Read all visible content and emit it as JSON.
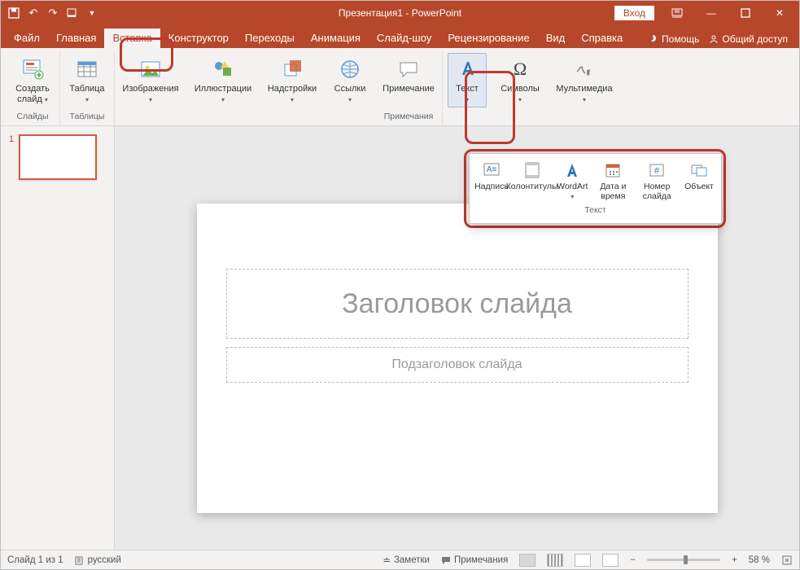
{
  "title": "Презентация1 - PowerPoint",
  "login_label": "Вход",
  "tabs": {
    "file": "Файл",
    "home": "Главная",
    "insert": "Вставка",
    "design": "Конструктор",
    "transitions": "Переходы",
    "animation": "Анимация",
    "slideshow": "Слайд-шоу",
    "review": "Рецензирование",
    "view": "Вид",
    "help": "Справка"
  },
  "tabs_right": {
    "tell_me": "Помощь",
    "share": "Общий доступ"
  },
  "ribbon": {
    "new_slide": "Создать слайд",
    "slides_group": "Слайды",
    "table": "Таблица",
    "tables_group": "Таблицы",
    "images": "Изображения",
    "illustrations": "Иллюстрации",
    "addins": "Надстройки",
    "links": "Ссылки",
    "comment": "Примечание",
    "comments_group": "Примечания",
    "text": "Текст",
    "symbols": "Символы",
    "media": "Мультимедиа"
  },
  "flyout": {
    "textbox": "Надпись",
    "headerfooter": "Колонтитулы",
    "wordart": "WordArt",
    "datetime": "Дата и время",
    "slidenum": "Номер слайда",
    "object": "Объект",
    "group": "Текст"
  },
  "slide": {
    "title_ph": "Заголовок слайда",
    "subtitle_ph": "Подзаголовок слайда",
    "thumb_num": "1"
  },
  "status": {
    "slide_count": "Слайд 1 из 1",
    "language": "русский",
    "notes": "Заметки",
    "comments": "Примечания",
    "zoom": "58 %"
  },
  "icons": {
    "save": "save-icon",
    "undo": "undo-icon",
    "redo": "redo-icon",
    "start": "start-from-beginning-icon"
  }
}
